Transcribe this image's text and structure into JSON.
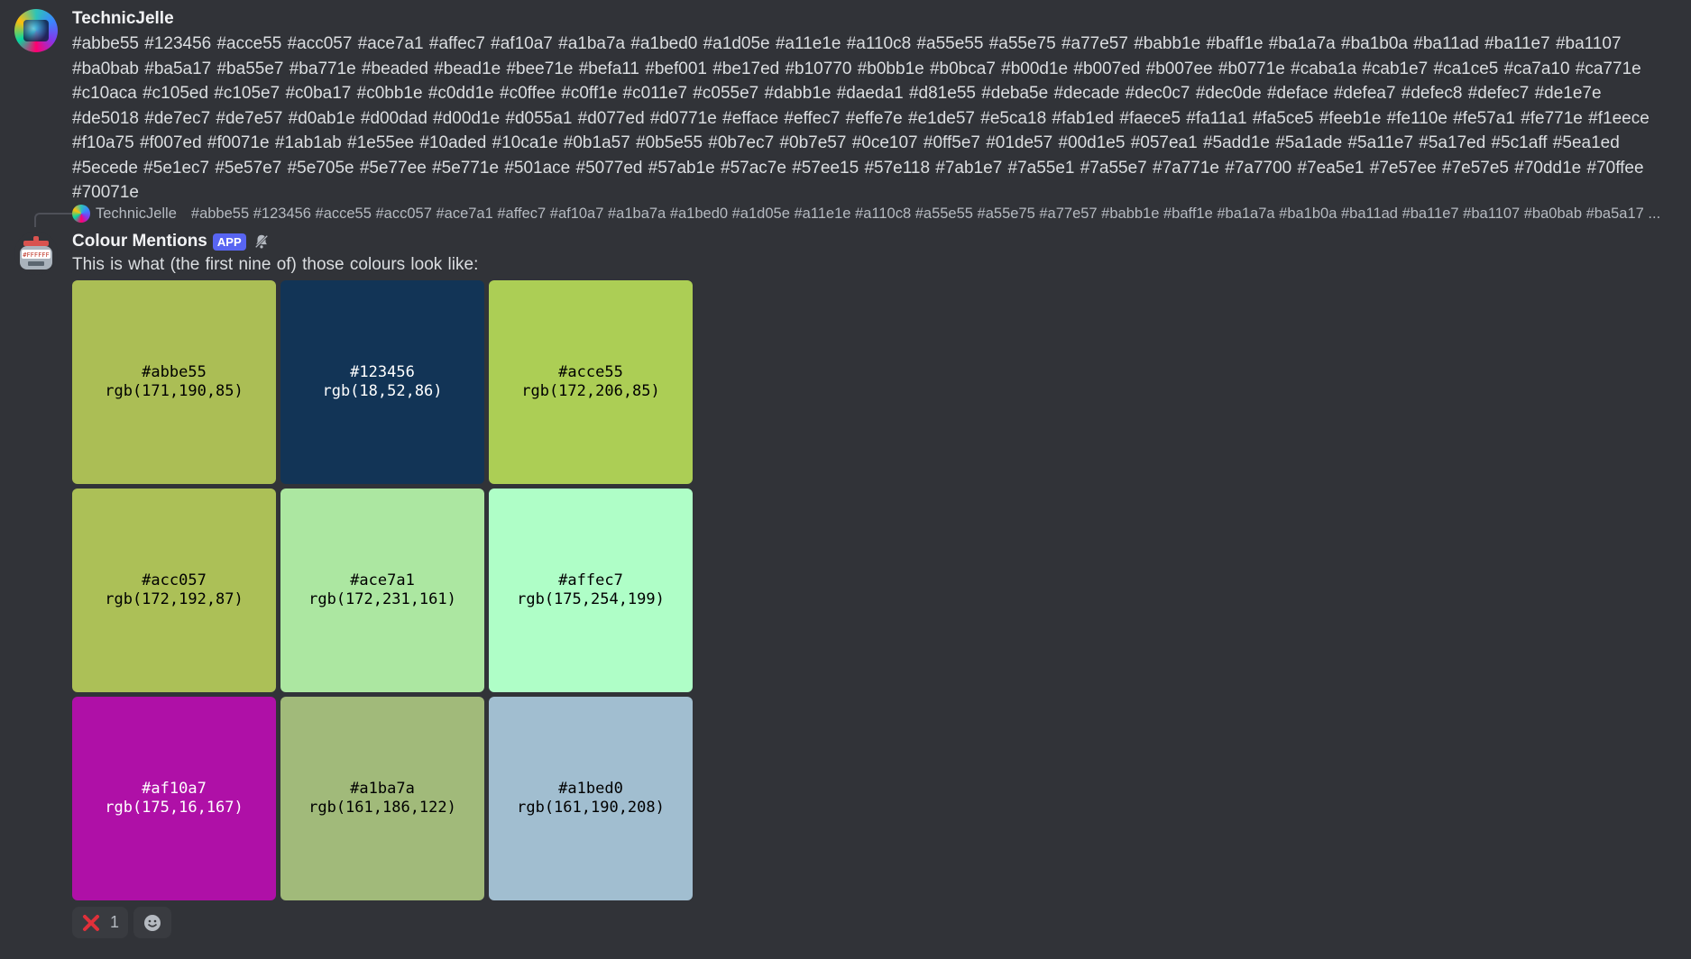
{
  "message1": {
    "username": "TechnicJelle",
    "text": "#abbe55 #123456 #acce55 #acc057 #ace7a1 #affec7 #af10a7 #a1ba7a #a1bed0 #a1d05e #a11e1e #a110c8 #a55e55 #a55e75 #a77e57 #babb1e #baff1e #ba1a7a #ba1b0a #ba11ad #ba11e7 #ba1107 #ba0bab #ba5a17 #ba55e7 #ba771e #beaded #bead1e #bee71e #befa11 #bef001 #be17ed #b10770 #b0bb1e #b0bca7 #b00d1e #b007ed #b007ee #b0771e #caba1a #cab1e7 #ca1ce5 #ca7a10 #ca771e #c10aca #c105ed #c105e7 #c0ba17 #c0bb1e #c0dd1e #c0ffee #c0ff1e #c011e7 #c055e7 #dabb1e #daeda1 #d81e55 #deba5e #decade #dec0c7 #dec0de #deface #defea7 #defec8 #defec7 #de1e7e #de5018 #de7ec7 #de7e57 #d0ab1e #d00dad #d00d1e #d055a1 #d077ed #d0771e #efface #effec7 #effe7e #e1de57 #e5ca18 #fab1ed #faece5 #fa11a1 #fa5ce5 #feeb1e #fe110e #fe57a1 #fe771e #f1eece #f10a75 #f007ed #f0071e #1ab1ab #1e55ee #10aded #10ca1e #0b1a57 #0b5e55 #0b7ec7 #0b7e57 #0ce107 #0ff5e7 #01de57 #00d1e5 #057ea1 #5add1e #5a1ade #5a11e7 #5a17ed #5c1aff #5ea1ed #5ecede #5e1ec7 #5e57e7 #5e705e #5e77ee #5e771e #501ace #5077ed #57ab1e #57ac7e #57ee15 #57e118 #7ab1e7 #7a55e1 #7a55e7 #7a771e #7a7700 #7ea5e1 #7e57ee #7e57e5 #70dd1e #70ffee #70071e"
  },
  "reply": {
    "username": "TechnicJelle",
    "preview": "#abbe55 #123456 #acce55 #acc057 #ace7a1 #affec7 #af10a7 #a1ba7a #a1bed0 #a1d05e #a11e1e #a110c8 #a55e55 #a55e75 #a77e57 #babb1e #baff1e #ba1a7a #ba1b0a #ba11ad #ba11e7 #ba1107 #ba0bab #ba5a17 ..."
  },
  "message2": {
    "botname": "Colour Mentions",
    "app_tag": "APP",
    "avatar_text": "#FFFFFF",
    "text": "This is what (the first nine of) those colours look like:"
  },
  "swatches": [
    {
      "hex": "#abbe55",
      "rgb": "rgb(171,190,85)",
      "fg": "#000000"
    },
    {
      "hex": "#123456",
      "rgb": "rgb(18,52,86)",
      "fg": "#ffffff"
    },
    {
      "hex": "#acce55",
      "rgb": "rgb(172,206,85)",
      "fg": "#000000"
    },
    {
      "hex": "#acc057",
      "rgb": "rgb(172,192,87)",
      "fg": "#000000"
    },
    {
      "hex": "#ace7a1",
      "rgb": "rgb(172,231,161)",
      "fg": "#000000"
    },
    {
      "hex": "#affec7",
      "rgb": "rgb(175,254,199)",
      "fg": "#000000"
    },
    {
      "hex": "#af10a7",
      "rgb": "rgb(175,16,167)",
      "fg": "#ffffff"
    },
    {
      "hex": "#a1ba7a",
      "rgb": "rgb(161,186,122)",
      "fg": "#000000"
    },
    {
      "hex": "#a1bed0",
      "rgb": "rgb(161,190,208)",
      "fg": "#000000"
    }
  ],
  "reactions": [
    {
      "emoji": "❌",
      "count": "1",
      "icon": "cross-mark-icon"
    }
  ],
  "icons": {
    "bell": "bell-muted-icon",
    "add_reaction": "add-reaction-icon"
  }
}
